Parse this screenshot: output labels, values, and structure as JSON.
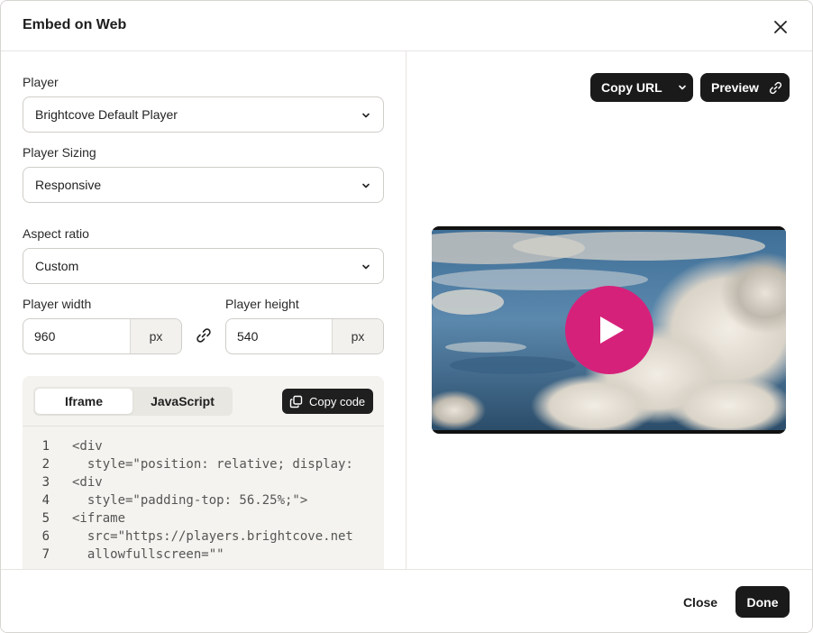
{
  "dialog": {
    "title": "Embed on Web"
  },
  "player": {
    "label": "Player",
    "value": "Brightcove Default Player"
  },
  "sizing": {
    "label": "Player Sizing",
    "value": "Responsive"
  },
  "aspect": {
    "label": "Aspect ratio",
    "value": "Custom"
  },
  "width": {
    "label": "Player width",
    "value": "960",
    "unit": "px"
  },
  "height": {
    "label": "Player height",
    "value": "540",
    "unit": "px"
  },
  "code": {
    "tabs": [
      {
        "label": "Iframe",
        "active": true
      },
      {
        "label": "JavaScript",
        "active": false
      }
    ],
    "copy_label": "Copy code",
    "lines": [
      {
        "n": "1",
        "text": "<div"
      },
      {
        "n": "2",
        "text": "  style=\"position: relative; display:"
      },
      {
        "n": "3",
        "text": "<div"
      },
      {
        "n": "4",
        "text": "  style=\"padding-top: 56.25%;\">"
      },
      {
        "n": "5",
        "text": "<iframe"
      },
      {
        "n": "6",
        "text": "  src=\"https://players.brightcove.net"
      },
      {
        "n": "7",
        "text": "  allowfullscreen=\"\""
      }
    ]
  },
  "preview": {
    "copy_url_label": "Copy URL",
    "preview_label": "Preview",
    "play_color": "#d6217a"
  },
  "footer": {
    "close_label": "Close",
    "done_label": "Done"
  }
}
